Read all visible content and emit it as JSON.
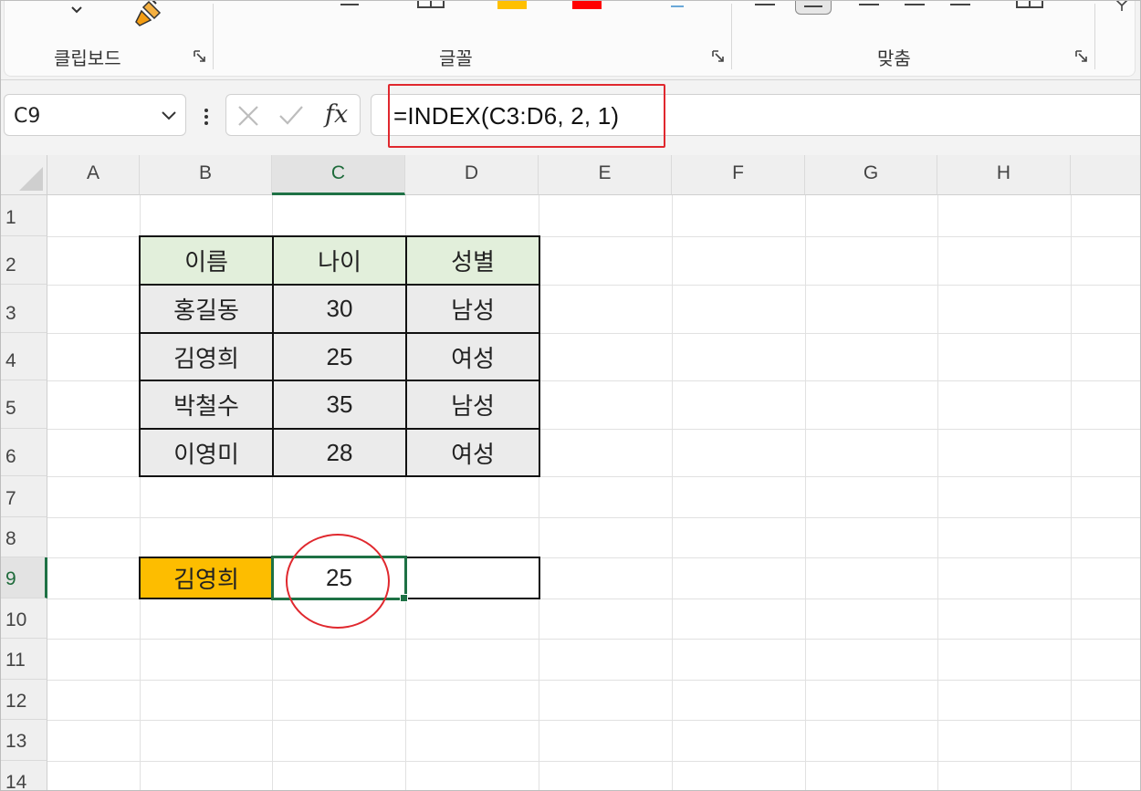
{
  "ribbon": {
    "groups": [
      {
        "label": "클립보드"
      },
      {
        "label": "글꼴"
      },
      {
        "label": "맞춤"
      }
    ],
    "font_color_hint": "#ff0000",
    "fill_color_hint": "#ffc000"
  },
  "formula_bar": {
    "name_box": "C9",
    "fx_label": "fx",
    "formula": "=INDEX(C3:D6, 2, 1)"
  },
  "grid": {
    "columns": [
      "A",
      "B",
      "C",
      "D",
      "E",
      "F",
      "G",
      "H"
    ],
    "rows": [
      "1",
      "2",
      "3",
      "4",
      "5",
      "6",
      "7",
      "8",
      "9",
      "10",
      "11",
      "12",
      "13",
      "14"
    ],
    "selected_column": "C",
    "selected_row": "9"
  },
  "table": {
    "headers": [
      "이름",
      "나이",
      "성별"
    ],
    "rows": [
      [
        "홍길동",
        "30",
        "남성"
      ],
      [
        "김영희",
        "25",
        "여성"
      ],
      [
        "박철수",
        "35",
        "남성"
      ],
      [
        "이영미",
        "28",
        "여성"
      ]
    ]
  },
  "lookup": {
    "label": "김영희",
    "result": "25",
    "label_color": "#fdbd00"
  },
  "colors": {
    "header_fill": "#e2efdb",
    "body_fill": "#ebebeb",
    "selection": "#1e7145",
    "annotation": "#e0282e"
  }
}
